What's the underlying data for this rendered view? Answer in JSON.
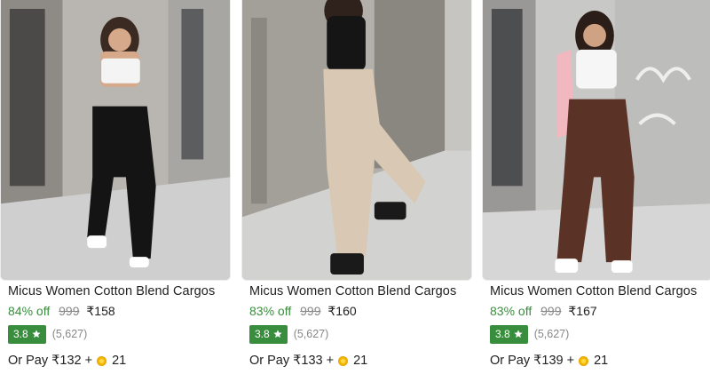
{
  "products": [
    {
      "title": "Micus Women Cotton Blend Cargos",
      "discount": "84% off",
      "mrp": "999",
      "price": "₹158",
      "rating": "3.8",
      "rating_count": "(5,627)",
      "pay_prefix": "Or Pay ₹132 +",
      "coins": "21",
      "image": {
        "pants_color": "#141414",
        "top_color": "#f4f4f4",
        "ground": "#cfcfcf",
        "wall": "#9e9a95"
      }
    },
    {
      "title": "Micus Women Cotton Blend Cargos",
      "discount": "83% off",
      "mrp": "999",
      "price": "₹160",
      "rating": "3.8",
      "rating_count": "(5,627)",
      "pay_prefix": "Or Pay ₹133 +",
      "coins": "21",
      "image": {
        "pants_color": "#d8c8b4",
        "top_color": "#151515",
        "ground": "#d2d2d0",
        "wall": "#b3b0ab"
      }
    },
    {
      "title": "Micus Women Cotton Blend Cargos",
      "discount": "83% off",
      "mrp": "999",
      "price": "₹167",
      "rating": "3.8",
      "rating_count": "(5,627)",
      "pay_prefix": "Or Pay ₹139 +",
      "coins": "21",
      "image": {
        "pants_color": "#5a3326",
        "top_color": "#f6f6f6",
        "ground": "#d6d6d6",
        "wall": "#c8c8c6"
      }
    }
  ],
  "colors": {
    "discount": "#388e3c",
    "badge": "#388e3c",
    "mrp": "#878787",
    "coin": "#f5b800"
  },
  "icons": {
    "rating": "star-icon",
    "coin": "supercoin-icon"
  }
}
